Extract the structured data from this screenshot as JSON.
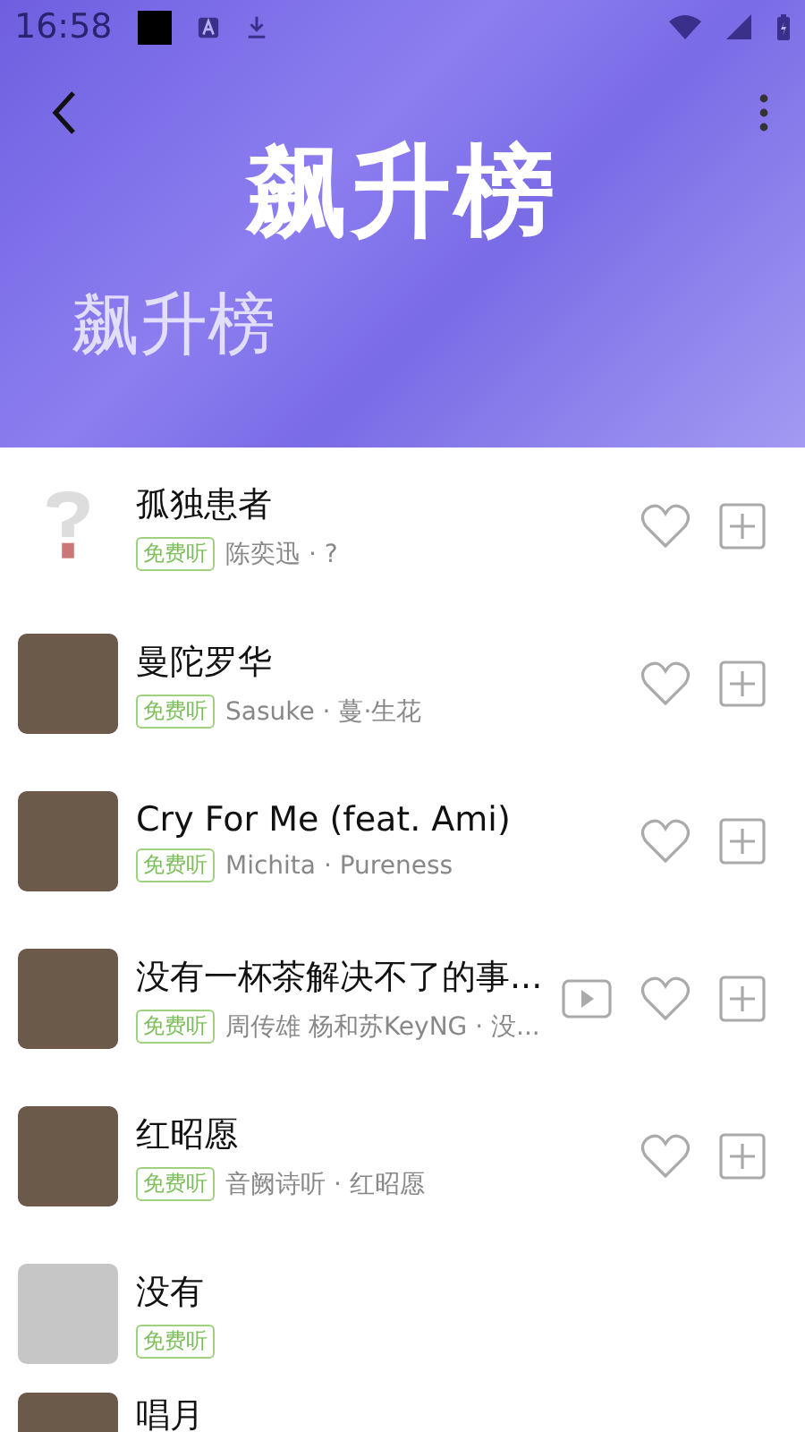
{
  "status_bar": {
    "time": "16:58"
  },
  "header": {
    "title": "飙升榜",
    "subtitle": "飙升榜"
  },
  "songs": [
    {
      "title": "孤独患者",
      "tag": "免费听",
      "artist": "陈奕迅 · ?",
      "cover": {
        "kind": "question"
      },
      "actions": [
        {
          "kind": "like"
        },
        {
          "kind": "add"
        }
      ]
    },
    {
      "title": "曼陀罗华",
      "tag": "免费听",
      "artist": "Sasuke · 蔓·生花",
      "cover": {
        "kind": "photo"
      },
      "actions": [
        {
          "kind": "like"
        },
        {
          "kind": "add"
        }
      ]
    },
    {
      "title": "Cry For Me (feat. Ami)",
      "tag": "免费听",
      "artist": "Michita · Pureness",
      "cover": {
        "kind": "photo"
      },
      "actions": [
        {
          "kind": "like"
        },
        {
          "kind": "add"
        }
      ]
    },
    {
      "title": "没有一杯茶解决不了的事...",
      "tag": "免费听",
      "artist": "周传雄 杨和苏KeyNG · 没...",
      "cover": {
        "kind": "photo"
      },
      "actions": [
        {
          "kind": "mv"
        },
        {
          "kind": "like"
        },
        {
          "kind": "add"
        }
      ]
    },
    {
      "title": "红昭愿",
      "tag": "免费听",
      "artist": "音阙诗听 · 红昭愿",
      "cover": {
        "kind": "photo"
      },
      "actions": [
        {
          "kind": "like"
        },
        {
          "kind": "add"
        }
      ]
    },
    {
      "title": "没有",
      "tag": "免费听",
      "cover": {
        "kind": "placeholder"
      }
    },
    {
      "title": "唱月",
      "cover": {
        "kind": "photo"
      }
    }
  ]
}
